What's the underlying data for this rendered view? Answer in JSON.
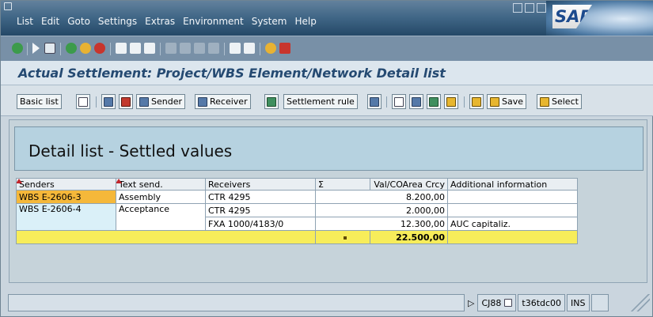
{
  "menu": {
    "items": [
      "List",
      "Edit",
      "Goto",
      "Settings",
      "Extras",
      "Environment",
      "System",
      "Help"
    ]
  },
  "brand": {
    "logo_text": "SAP"
  },
  "title": "Actual Settlement: Project/WBS Element/Network Detail list",
  "app_toolbar": {
    "basic_list": "Basic list",
    "sender": "Sender",
    "receiver": "Receiver",
    "settlement_rule": "Settlement rule",
    "save": "Save",
    "select": "Select"
  },
  "header_box": {
    "title": "Detail list - Settled values"
  },
  "table": {
    "columns": [
      "Senders",
      "Text send.",
      "Receivers",
      "Σ",
      "Val/COArea Crcy",
      "Additional information"
    ],
    "rows": [
      {
        "sender": "WBS E-2606-3",
        "text": "Assembly",
        "receiver": "CTR 4295",
        "value": "8.200,00",
        "info": ""
      },
      {
        "sender": "WBS E-2606-4",
        "text": "Acceptance",
        "receiver": "CTR 4295",
        "value": "2.000,00",
        "info": ""
      },
      {
        "sender": "",
        "text": "",
        "receiver": "FXA 1000/4183/0",
        "value": "12.300,00",
        "info": "AUC capitaliz."
      }
    ],
    "total": "22.500,00"
  },
  "status": {
    "play_icon": "▷",
    "transaction": "CJ88",
    "server": "t36tdc00",
    "mode": "INS"
  },
  "colors": {
    "menubar": "#3f6585",
    "title_text": "#254a72",
    "highlight": "#f5b83a",
    "total_row": "#f7ed5a",
    "header_panel": "#b6d2e0"
  }
}
